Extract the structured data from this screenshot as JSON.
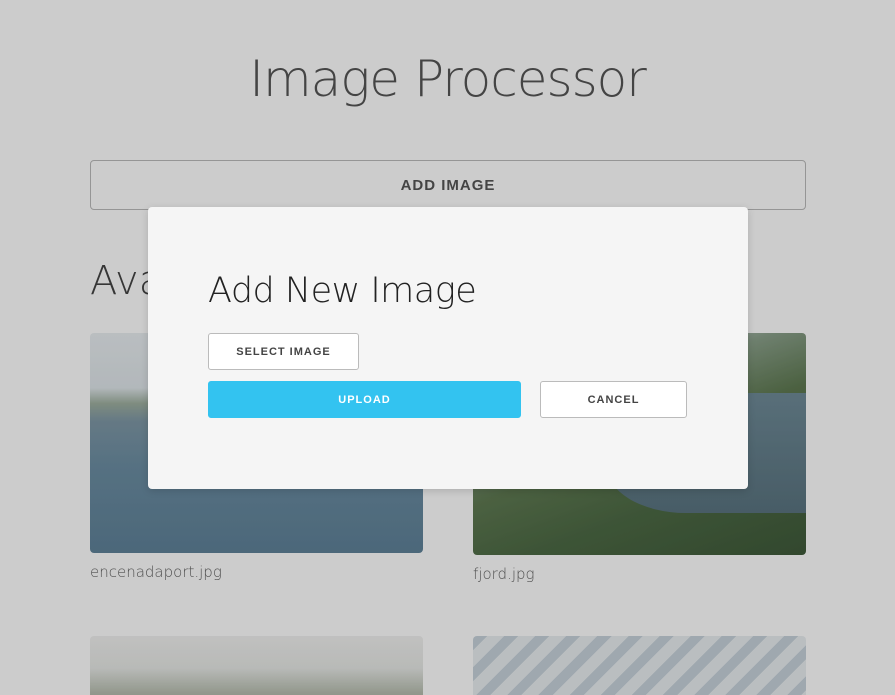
{
  "page": {
    "title": "Image Processor",
    "add_image_label": "ADD IMAGE",
    "section_heading": "Available Images"
  },
  "images": [
    {
      "filename": "encenadaport.jpg"
    },
    {
      "filename": "fjord.jpg"
    },
    {
      "filename": ""
    },
    {
      "filename": ""
    }
  ],
  "modal": {
    "title": "Add New Image",
    "select_label": "SELECT IMAGE",
    "upload_label": "UPLOAD",
    "cancel_label": "CANCEL"
  },
  "colors": {
    "accent": "#33c3f0",
    "overlay": "rgba(0,0,0,0.2)"
  }
}
